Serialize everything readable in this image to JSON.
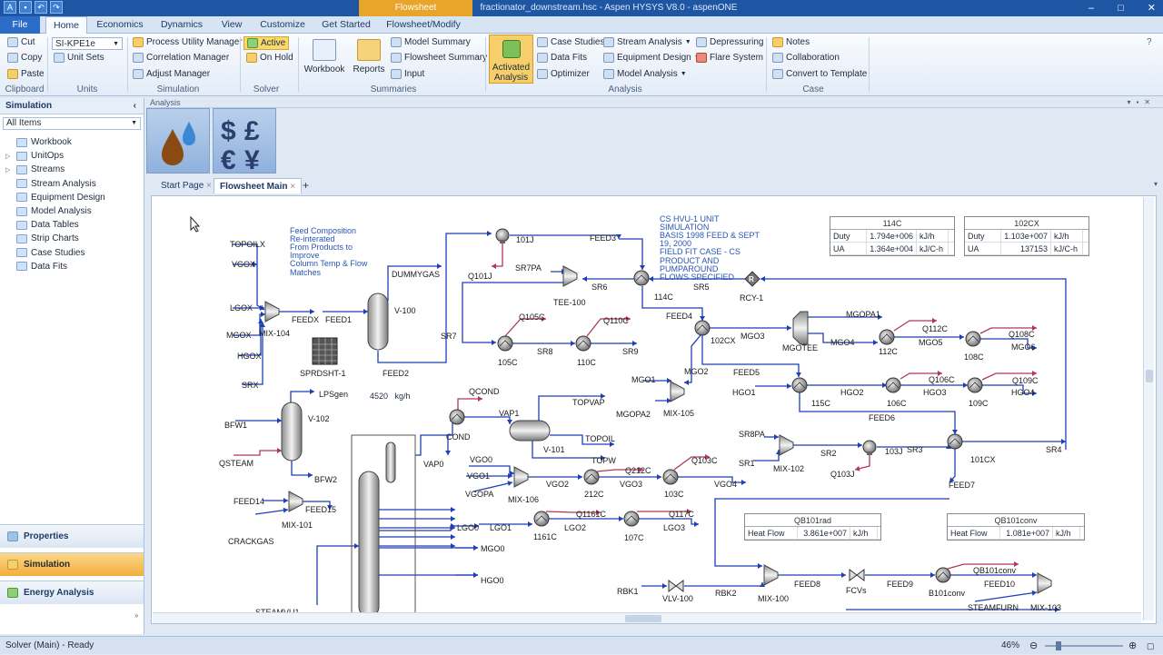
{
  "title_bar": {
    "contextual_tab": "Flowsheet",
    "window_title": "fractionator_downstream.hsc - Aspen HYSYS V8.0 - aspenONE",
    "min": "–",
    "max": "□",
    "close": "✕"
  },
  "ribbon_tabs": [
    "File",
    "Home",
    "Economics",
    "Dynamics",
    "View",
    "Customize",
    "Get Started",
    "Flowsheet/Modify"
  ],
  "ribbon": {
    "clipboard": {
      "cut": "Cut",
      "copy": "Copy",
      "paste": "Paste",
      "group": "Clipboard"
    },
    "units": {
      "unit_set_value": "SI-KPE1e",
      "unit_sets": "Unit Sets",
      "group": "Units"
    },
    "simulation": {
      "pum": "Process Utility Manager",
      "corr": "Correlation Manager",
      "adj": "Adjust Manager",
      "group": "Simulation"
    },
    "solver": {
      "active": "Active",
      "onhold": "On Hold",
      "group": "Solver"
    },
    "summaries": {
      "workbook": "Workbook",
      "reports": "Reports",
      "model_summary": "Model Summary",
      "flowsheet_summary": "Flowsheet Summary",
      "input": "Input",
      "group": "Summaries"
    },
    "analysis": {
      "activated": "Activated Analysis",
      "case_studies": "Case Studies",
      "data_fits": "Data Fits",
      "optimizer": "Optimizer",
      "stream_analysis": "Stream Analysis",
      "equipment_design": "Equipment Design",
      "model_analysis": "Model Analysis",
      "depressuring": "Depressuring",
      "flare_system": "Flare System",
      "group": "Analysis"
    },
    "case": {
      "notes": "Notes",
      "collaboration": "Collaboration",
      "convert": "Convert to Template",
      "group": "Case"
    }
  },
  "left_panel": {
    "header": "Simulation",
    "collapse": "‹",
    "filter": "All Items",
    "tree": [
      {
        "label": "Workbook",
        "expandable": false
      },
      {
        "label": "UnitOps",
        "expandable": true
      },
      {
        "label": "Streams",
        "expandable": true
      },
      {
        "label": "Stream Analysis",
        "expandable": false
      },
      {
        "label": "Equipment Design",
        "expandable": false
      },
      {
        "label": "Model Analysis",
        "expandable": false
      },
      {
        "label": "Data Tables",
        "expandable": false
      },
      {
        "label": "Strip Charts",
        "expandable": false
      },
      {
        "label": "Case Studies",
        "expandable": false
      },
      {
        "label": "Data Fits",
        "expandable": false
      }
    ],
    "nav": [
      {
        "label": "Properties",
        "selected": false
      },
      {
        "label": "Simulation",
        "selected": true
      },
      {
        "label": "Energy Analysis",
        "selected": false
      }
    ]
  },
  "analysis_pane": {
    "title": "Analysis",
    "icons": [
      "oil-drop-icon",
      "currency-icon"
    ]
  },
  "doc_tabs": [
    {
      "label": "Start Page",
      "selected": false
    },
    {
      "label": "Flowsheet Main",
      "selected": true
    }
  ],
  "flowsheet": {
    "feed_note": [
      "Feed Composition",
      "Re-interated",
      "From Products to",
      "Improve",
      "Column Temp & Flow",
      "Matches"
    ],
    "cs_note": [
      "CS HVU-1 UNIT",
      "SIMULATION",
      "BASIS 1998 FEED & SEPT",
      "19, 2000",
      "FIELD FIT CASE - CS",
      "PRODUCT AND",
      "PUMPAROUND",
      "FLOWS SPECIFIED"
    ],
    "sprd_value": "4520",
    "sprd_unit": "kg/h",
    "tables": [
      {
        "title": "114C",
        "rows": [
          [
            "Duty",
            "1.794e+006",
            "kJ/h"
          ],
          [
            "UA",
            "1.364e+004",
            "kJ/C-h"
          ]
        ]
      },
      {
        "title": "102CX",
        "rows": [
          [
            "Duty",
            "1.103e+007",
            "kJ/h"
          ],
          [
            "UA",
            "137153",
            "kJ/C-h"
          ]
        ]
      },
      {
        "title": "QB101rad",
        "rows": [
          [
            "Heat Flow",
            "3.861e+007",
            "kJ/h"
          ]
        ]
      },
      {
        "title": "QB101conv",
        "rows": [
          [
            "Heat Flow",
            "1.081e+007",
            "kJ/h"
          ]
        ]
      }
    ],
    "labels": {
      "topoilx": "TOPOILX",
      "vgox": "VGOX",
      "lgox": "LGOX",
      "mgox": "MGOX",
      "hgox": "HGOX",
      "srx": "SRX",
      "mix104": "MIX-104",
      "feedx": "FEEDX",
      "feed1": "FEED1",
      "v100": "V-100",
      "dummygas": "DUMMYGAS",
      "feed2": "FEED2",
      "sprdsht": "SPRDSHT-1",
      "lpsgen": "LPSgen",
      "bfw1": "BFW1",
      "v102": "V-102",
      "qsteam": "QSTEAM",
      "bfw2": "BFW2",
      "feed14": "FEED14",
      "mix101": "MIX-101",
      "feed15": "FEED15",
      "crackgas": "CRACKGAS",
      "steamvu": "STEAMVU1",
      "p101j": "101J",
      "q101j": "Q101J",
      "feed3": "FEED3",
      "sr7pa": "SR7PA",
      "tee100": "TEE-100",
      "sr6": "SR6",
      "e114c": "114C",
      "sr5": "SR5",
      "rcy1": "RCY-1",
      "sr7": "SR7",
      "q105c": "Q105C",
      "q110c": "Q110C",
      "e105c": "105C",
      "sr8": "SR8",
      "e110c": "110C",
      "sr9": "SR9",
      "feed4": "FEED4",
      "e102cx": "102CX",
      "mgo3": "MGO3",
      "mgotee": "MGOTEE",
      "mgopa1": "MGOPA1",
      "mgo4": "MGO4",
      "e112c": "112C",
      "mgo5": "MGO5",
      "q112c": "Q112C",
      "e108c": "108C",
      "q108c": "Q108C",
      "mgo6": "MGO6",
      "feed5": "FEED5",
      "mgo1": "MGO1",
      "mgo2": "MGO2",
      "mix105": "MIX-105",
      "mgopa2": "MGOPA2",
      "hgo1": "HGO1",
      "e115c": "115C",
      "hgo2": "HGO2",
      "e106c": "106C",
      "q106c": "Q106C",
      "hgo3": "HGO3",
      "e109c": "109C",
      "q109c": "Q109C",
      "hgo4": "HGO4",
      "feed6": "FEED6",
      "qcond": "QCOND",
      "cond": "COND",
      "vap1": "VAP1",
      "topvap": "TOPVAP",
      "v101": "V-101",
      "topoil": "TOPOIL",
      "vap0": "VAP0",
      "topw": "TOPW",
      "vgo0": "VGO0",
      "vgo1": "VGO1",
      "vgopa": "VGOPA",
      "mix106": "MIX-106",
      "vgo2": "VGO2",
      "e212c": "212C",
      "q212c": "Q212C",
      "vgo3": "VGO3",
      "e103c": "103C",
      "q103c": "Q103C",
      "vgo4": "VGO4",
      "sr8pa": "SR8PA",
      "sr1": "SR1",
      "mix102": "MIX-102",
      "sr2": "SR2",
      "p103j": "103J",
      "q103j": "Q103J",
      "sr3": "SR3",
      "e101cx": "101CX",
      "sr4": "SR4",
      "feed7": "FEED7",
      "lgo0": "LGO0",
      "lgo1": "LGO1",
      "e1161c": "1161C",
      "q1161c": "Q1161C",
      "lgo2": "LGO2",
      "e107c": "107C",
      "q117c": "Q117C",
      "lgo3": "LGO3",
      "mgo0": "MGO0",
      "hgo0": "HGO0",
      "rbk1": "RBK1",
      "vlv100": "VLV-100",
      "rbk2": "RBK2",
      "mix100": "MIX-100",
      "feed8": "FEED8",
      "fcvs": "FCVs",
      "feed9": "FEED9",
      "b101conv": "B101conv",
      "qb101conv": "QB101conv",
      "feed10": "FEED10",
      "steamfurn": "STEAMFURN",
      "mix103": "MIX-103"
    }
  },
  "status": {
    "text": "Solver (Main) - Ready",
    "zoom": "46%"
  }
}
